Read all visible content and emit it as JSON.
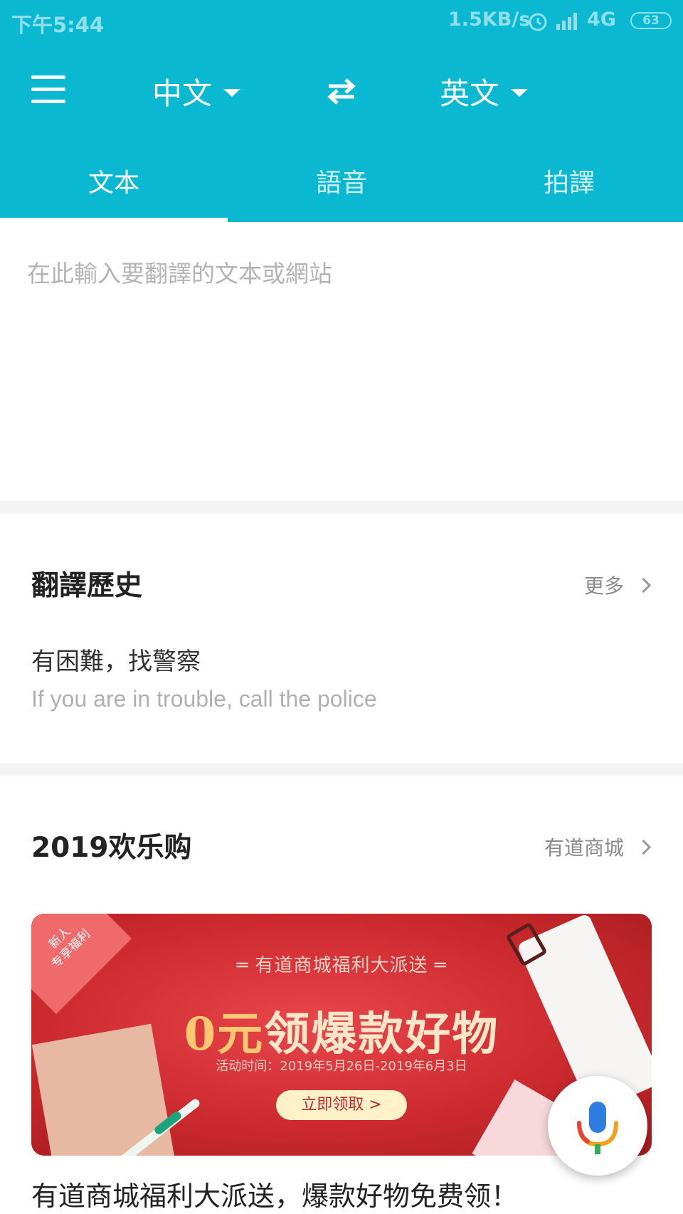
{
  "status_bar": {
    "time": "下午5:44",
    "speed": "1.5KB/s",
    "network": "4G",
    "battery": "63"
  },
  "header": {
    "source_lang": "中文",
    "target_lang": "英文",
    "tabs": [
      {
        "label": "文本",
        "active": true
      },
      {
        "label": "語音",
        "active": false
      },
      {
        "label": "拍譯",
        "active": false
      }
    ],
    "bg_color": "#0bb8d1"
  },
  "input": {
    "placeholder": "在此輸入要翻譯的文本或網站",
    "value": ""
  },
  "history": {
    "title": "翻譯歷史",
    "more_label": "更多",
    "items": [
      {
        "source": "有困難，找警察",
        "translation": "If you are in trouble, call the police"
      }
    ]
  },
  "shop": {
    "title": "2019欢乐购",
    "link_label": "有道商城",
    "banner": {
      "corner_tag": "新人\n专享福利",
      "subtitle": "═ 有道商城福利大派送 ═",
      "headline_zero": "0元",
      "headline_rest": "领爆款好物",
      "date": "活动时间：2019年5月26日-2019年6月3日",
      "button": "立即领取 >"
    },
    "article_title": "有道商城福利大派送，爆款好物免费领！"
  },
  "icons": {
    "menu": "menu-icon",
    "swap": "swap-arrows-icon",
    "mic": "microphone-icon"
  }
}
